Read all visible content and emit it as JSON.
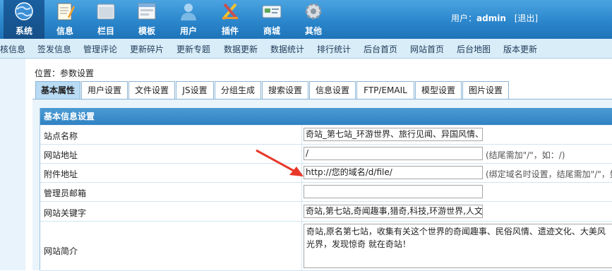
{
  "topnav": {
    "items": [
      {
        "label": "系统",
        "icon": "globe-icon",
        "active": true
      },
      {
        "label": "信息",
        "icon": "notepad-icon"
      },
      {
        "label": "栏目",
        "icon": "folder-icon"
      },
      {
        "label": "模板",
        "icon": "window-icon"
      },
      {
        "label": "用户",
        "icon": "user-icon"
      },
      {
        "label": "插件",
        "icon": "tools-icon"
      },
      {
        "label": "商城",
        "icon": "card-icon"
      },
      {
        "label": "其他",
        "icon": "gear-icon"
      }
    ],
    "user_prefix": "用户：",
    "username": "admin",
    "logout": "[退出]"
  },
  "submenu": {
    "items": [
      "核信息",
      "签发信息",
      "管理评论",
      "更新碎片",
      "更新专题",
      "数据更新",
      "数据统计",
      "排行统计",
      "后台首页",
      "网站首页",
      "后台地图",
      "版本更新"
    ]
  },
  "location": "位置：参数设置",
  "tabs": [
    "基本属性",
    "用户设置",
    "文件设置",
    "JS设置",
    "分组生成",
    "搜索设置",
    "信息设置",
    "FTP/EMAIL",
    "模型设置",
    "图片设置"
  ],
  "form": {
    "title": "基本信息设置",
    "rows": [
      {
        "label": "站点名称",
        "value": "奇站_第七站_环游世界、旅行见闻、异国风情、",
        "hint": ""
      },
      {
        "label": "网站地址",
        "value": "/",
        "hint": "(结尾需加\"/\"，如：/)"
      },
      {
        "label": "附件地址",
        "value": "http://您的域名/d/file/",
        "hint": "(绑定域名时设置，结尾需加\"/\"，如"
      },
      {
        "label": "管理员邮箱",
        "value": "",
        "hint": ""
      },
      {
        "label": "网站关键字",
        "value": "奇站,第七站,奇闻趣事,猎奇,科技,环游世界,人文",
        "hint": ""
      },
      {
        "label": "网站简介",
        "value": "奇站,原名第七站，收集有关这个世界的奇闻趣事、民俗风情、遗迹文化、大美风光界，发现惊奇 就在奇站！",
        "hint": ""
      }
    ]
  },
  "colors": {
    "topbar": "#2b86cc",
    "submenu": "#d9edf9",
    "form_head": "#3a8ccb",
    "arrow": "#e8382a"
  }
}
